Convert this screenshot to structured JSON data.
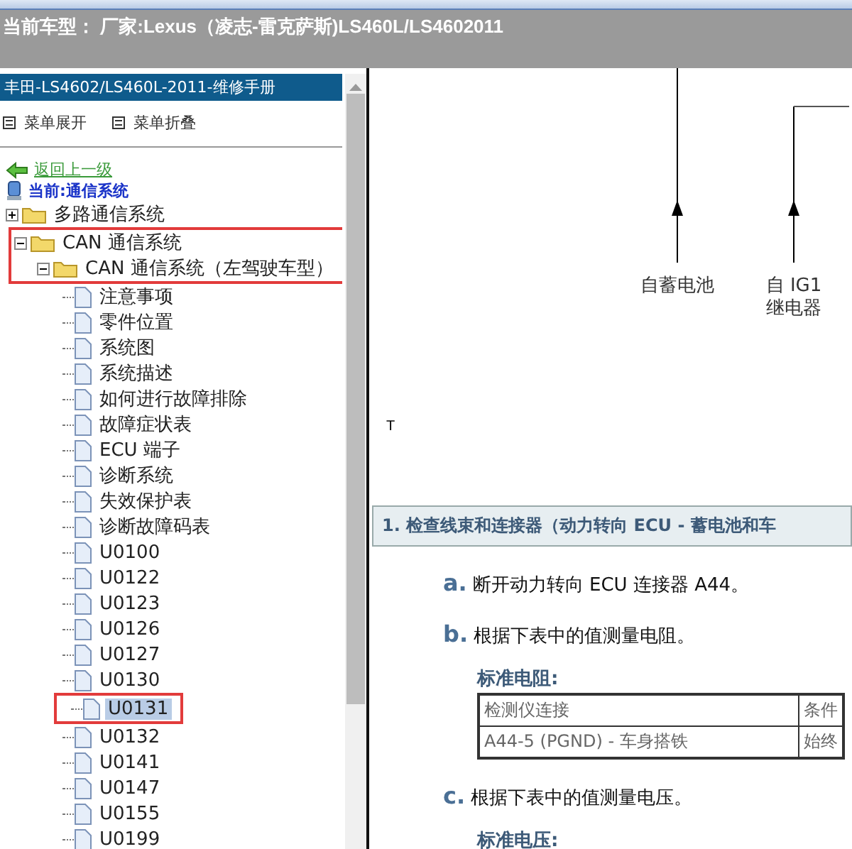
{
  "title": "当前车型： 厂家:Lexus（凌志-雷克萨斯)LS460L/LS4602011",
  "sidebar": {
    "header": "丰田-LS4602/LS460L-2011-维修手册",
    "menu_actions": [
      "菜单展开",
      "菜单折叠"
    ],
    "back_link": "返回上一级",
    "current": "当前:通信系统",
    "tree": [
      {
        "kind": "folder",
        "label": "多路通信系统",
        "expanded": false,
        "annotated": false
      },
      {
        "kind": "folder",
        "label": "CAN 通信系统",
        "expanded": true,
        "annotated": true,
        "children": [
          {
            "kind": "folder",
            "label": "CAN 通信系统（左驾驶车型）",
            "expanded": true,
            "annotated": true,
            "children": [
              {
                "kind": "page",
                "label": "注意事项",
                "selected": false,
                "annotated": false
              },
              {
                "kind": "page",
                "label": "零件位置",
                "selected": false,
                "annotated": false
              },
              {
                "kind": "page",
                "label": "系统图",
                "selected": false,
                "annotated": false
              },
              {
                "kind": "page",
                "label": "系统描述",
                "selected": false,
                "annotated": false
              },
              {
                "kind": "page",
                "label": "如何进行故障排除",
                "selected": false,
                "annotated": false
              },
              {
                "kind": "page",
                "label": "故障症状表",
                "selected": false,
                "annotated": false
              },
              {
                "kind": "page",
                "label": "ECU 端子",
                "selected": false,
                "annotated": false
              },
              {
                "kind": "page",
                "label": "诊断系统",
                "selected": false,
                "annotated": false
              },
              {
                "kind": "page",
                "label": "失效保护表",
                "selected": false,
                "annotated": false
              },
              {
                "kind": "page",
                "label": "诊断故障码表",
                "selected": false,
                "annotated": false
              },
              {
                "kind": "page",
                "label": "U0100",
                "selected": false,
                "annotated": false
              },
              {
                "kind": "page",
                "label": "U0122",
                "selected": false,
                "annotated": false
              },
              {
                "kind": "page",
                "label": "U0123",
                "selected": false,
                "annotated": false
              },
              {
                "kind": "page",
                "label": "U0126",
                "selected": false,
                "annotated": false
              },
              {
                "kind": "page",
                "label": "U0127",
                "selected": false,
                "annotated": false
              },
              {
                "kind": "page",
                "label": "U0130",
                "selected": false,
                "annotated": false
              },
              {
                "kind": "page",
                "label": "U0131",
                "selected": true,
                "annotated": true
              },
              {
                "kind": "page",
                "label": "U0132",
                "selected": false,
                "annotated": false
              },
              {
                "kind": "page",
                "label": "U0141",
                "selected": false,
                "annotated": false
              },
              {
                "kind": "page",
                "label": "U0147",
                "selected": false,
                "annotated": false
              },
              {
                "kind": "page",
                "label": "U0155",
                "selected": false,
                "annotated": false
              },
              {
                "kind": "page",
                "label": "U0199",
                "selected": false,
                "annotated": false
              }
            ]
          }
        ]
      }
    ]
  },
  "diagram": {
    "wires": [
      {
        "lines": [
          "自蓄电池"
        ]
      },
      {
        "lines": [
          "自 IG1",
          "继电器"
        ]
      }
    ],
    "terminal_label": "T"
  },
  "section": {
    "heading": "1. 检查线束和连接器（动力转向 ECU - 蓄电池和车",
    "steps": [
      {
        "letter": "a.",
        "text": "断开动力转向 ECU 连接器 A44。"
      },
      {
        "letter": "b.",
        "text": "根据下表中的值测量电阻。",
        "spec": {
          "title": "标准电阻:",
          "columns": [
            "检测仪连接",
            "条件"
          ],
          "rows": [
            [
              "A44-5 (PGND) - 车身搭铁",
              "始终"
            ]
          ]
        }
      },
      {
        "letter": "c.",
        "text": "根据下表中的值测量电压。",
        "spec": {
          "title": "标准电压:"
        }
      }
    ]
  }
}
